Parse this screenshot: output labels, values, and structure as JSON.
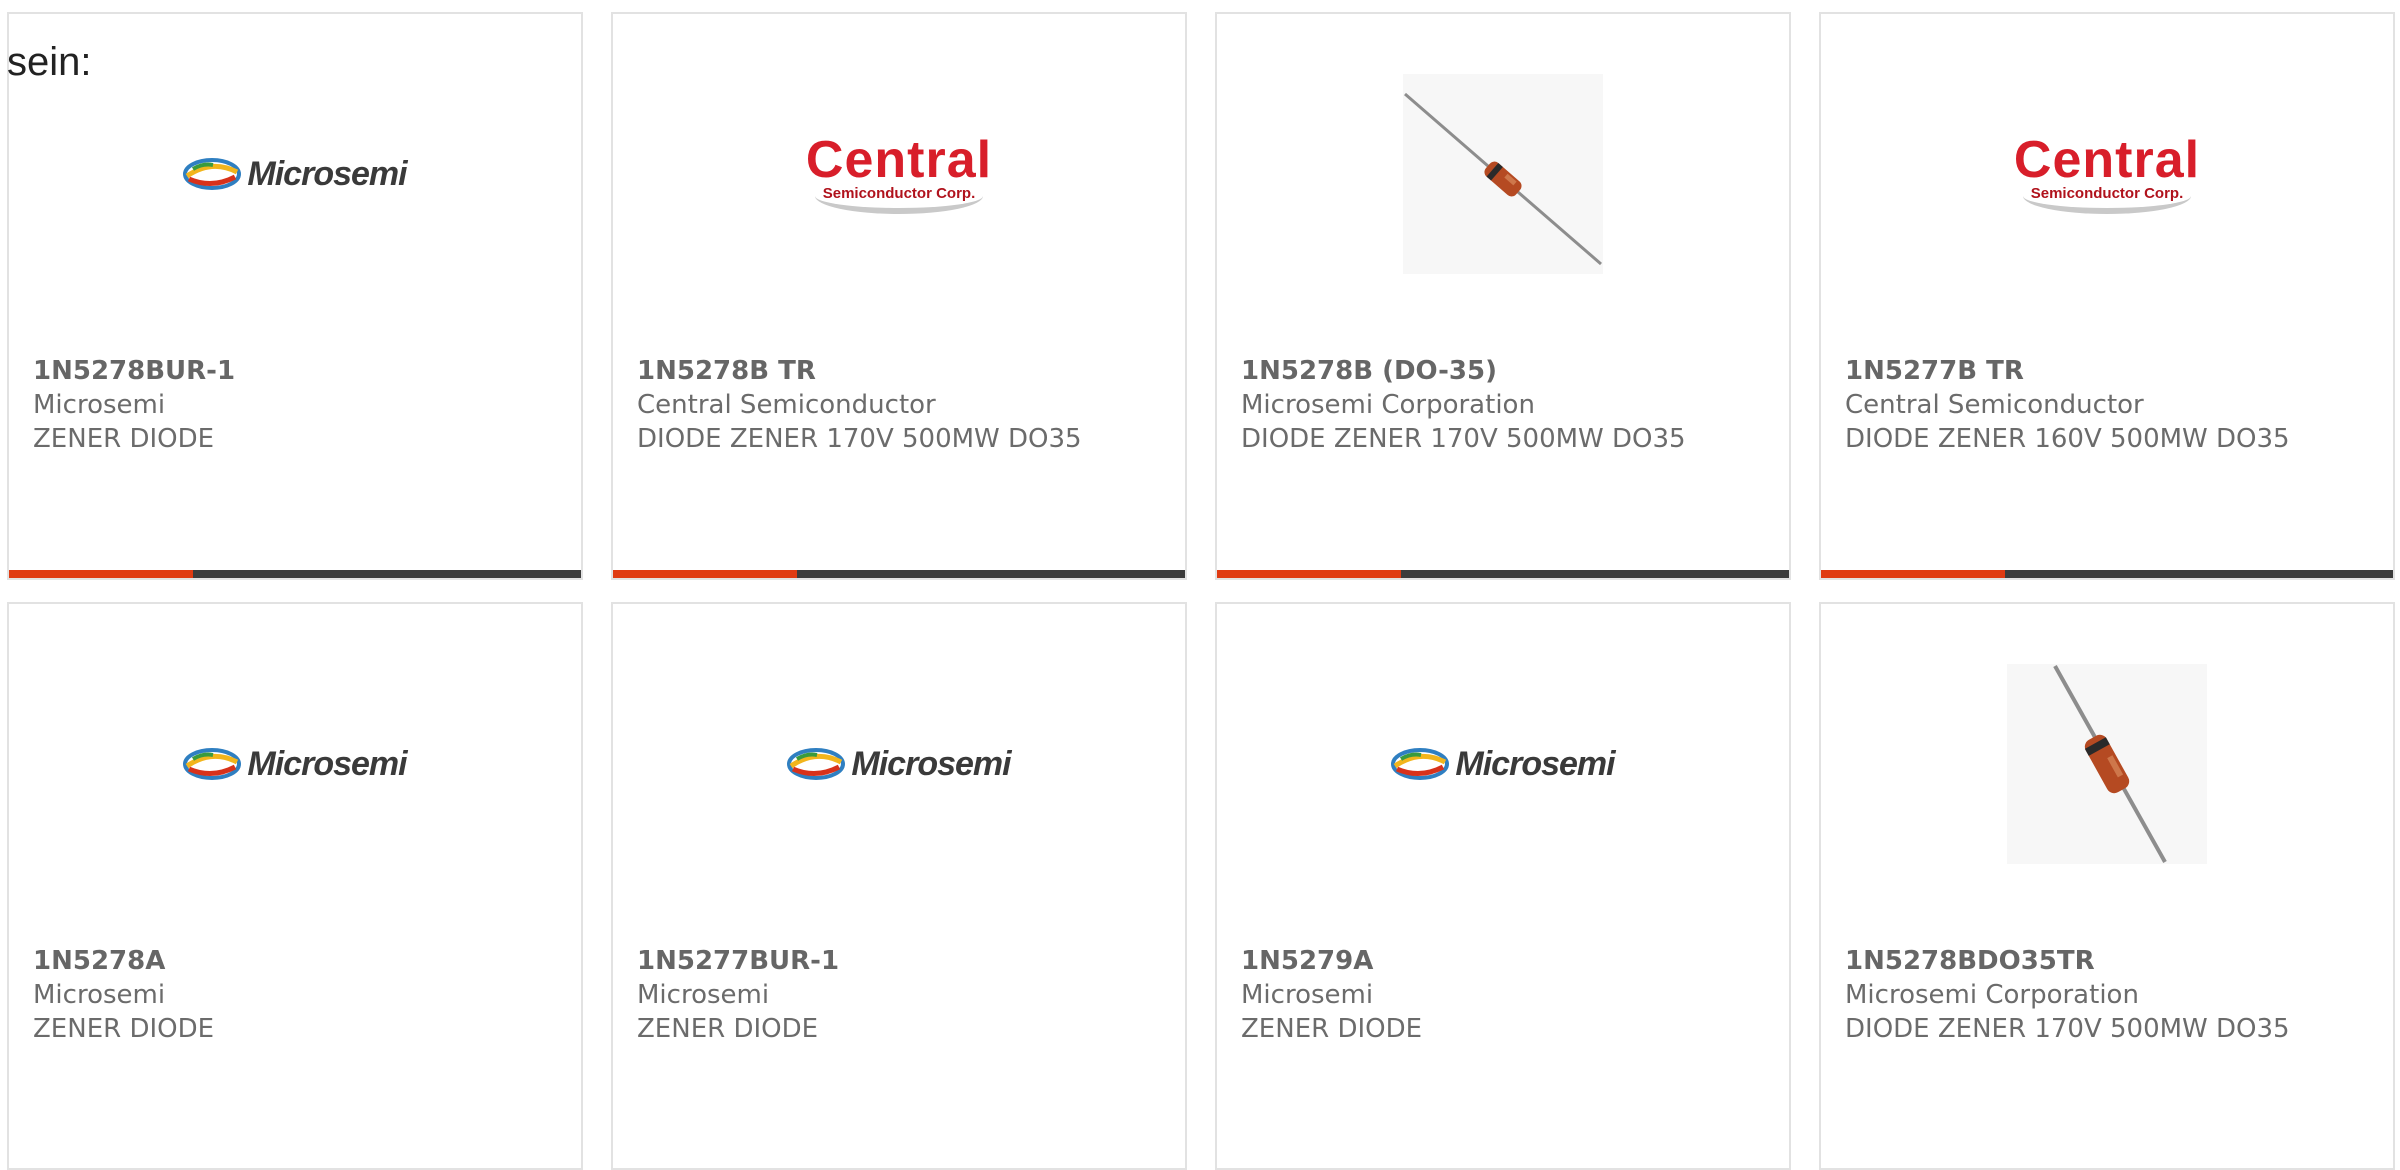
{
  "intro_text": "sein:",
  "colors": {
    "accent": "#e03b12",
    "bar": "#3c3c3c",
    "text": "#6b6b6b"
  },
  "products": [
    {
      "part": "1N5278BUR-1",
      "manufacturer": "Microsemi",
      "description": "ZENER DIODE",
      "image": "microsemi-logo",
      "logo_text": "Microsemi"
    },
    {
      "part": "1N5278B TR",
      "manufacturer": "Central Semiconductor",
      "description": "DIODE ZENER 170V 500MW DO35",
      "image": "central-logo",
      "logo_text": "Central",
      "logo_subtext": "Semiconductor Corp."
    },
    {
      "part": "1N5278B (DO-35)",
      "manufacturer": "Microsemi Corporation",
      "description": "DIODE ZENER 170V 500MW DO35",
      "image": "diode-photo"
    },
    {
      "part": "1N5277B TR",
      "manufacturer": "Central Semiconductor",
      "description": "DIODE ZENER 160V 500MW DO35",
      "image": "central-logo",
      "logo_text": "Central",
      "logo_subtext": "Semiconductor Corp."
    },
    {
      "part": "1N5278A",
      "manufacturer": "Microsemi",
      "description": "ZENER DIODE",
      "image": "microsemi-logo",
      "logo_text": "Microsemi"
    },
    {
      "part": "1N5277BUR-1",
      "manufacturer": "Microsemi",
      "description": "ZENER DIODE",
      "image": "microsemi-logo",
      "logo_text": "Microsemi"
    },
    {
      "part": "1N5279A",
      "manufacturer": "Microsemi",
      "description": "ZENER DIODE",
      "image": "microsemi-logo",
      "logo_text": "Microsemi"
    },
    {
      "part": "1N5278BDO35TR",
      "manufacturer": "Microsemi Corporation",
      "description": "DIODE ZENER 170V 500MW DO35",
      "image": "diode-photo"
    }
  ]
}
